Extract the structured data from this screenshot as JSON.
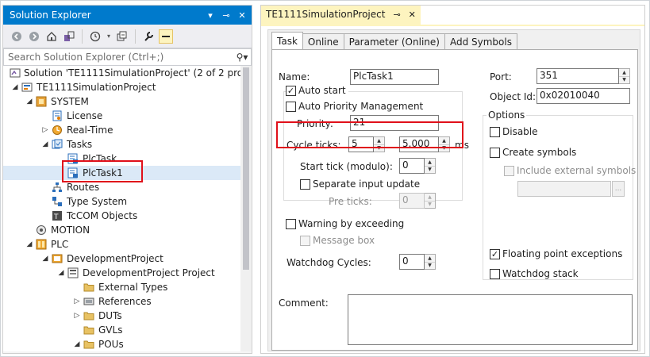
{
  "solution_explorer": {
    "title": "Solution Explorer",
    "title_icons": [
      "dropdown-arrow-icon",
      "pin-icon",
      "close-icon"
    ],
    "search_placeholder": "Search Solution Explorer (Ctrl+;)",
    "tree": [
      {
        "label": "Solution 'TE1111SimulationProject' (2 of 2 project",
        "icon": "solution-icon",
        "level": 0,
        "arrow": ""
      },
      {
        "label": "TE1111SimulationProject",
        "icon": "twincat-project-icon",
        "level": 0,
        "arrow": "expanded"
      },
      {
        "label": "SYSTEM",
        "icon": "system-icon",
        "level": 1,
        "arrow": "expanded"
      },
      {
        "label": "License",
        "icon": "license-icon",
        "level": 2,
        "arrow": ""
      },
      {
        "label": "Real-Time",
        "icon": "realtime-icon",
        "level": 2,
        "arrow": "collapsed"
      },
      {
        "label": "Tasks",
        "icon": "tasks-icon",
        "level": 2,
        "arrow": "expanded"
      },
      {
        "label": "PlcTask",
        "icon": "task-icon",
        "level": 3,
        "arrow": ""
      },
      {
        "label": "PlcTask1",
        "icon": "task-icon",
        "level": 3,
        "arrow": "",
        "selected": true
      },
      {
        "label": "Routes",
        "icon": "routes-icon",
        "level": 2,
        "arrow": ""
      },
      {
        "label": "Type System",
        "icon": "type-system-icon",
        "level": 2,
        "arrow": ""
      },
      {
        "label": "TcCOM Objects",
        "icon": "tccom-icon",
        "level": 2,
        "arrow": ""
      },
      {
        "label": "MOTION",
        "icon": "motion-icon",
        "level": 1,
        "arrow": ""
      },
      {
        "label": "PLC",
        "icon": "plc-icon",
        "level": 1,
        "arrow": "expanded"
      },
      {
        "label": "DevelopmentProject",
        "icon": "plc-project-icon",
        "level": 2,
        "arrow": "expanded"
      },
      {
        "label": "DevelopmentProject Project",
        "icon": "plc-project-file-icon",
        "level": 3,
        "arrow": "expanded"
      },
      {
        "label": "External Types",
        "icon": "folder-icon",
        "level": 4,
        "arrow": ""
      },
      {
        "label": "References",
        "icon": "references-icon",
        "level": 4,
        "arrow": "collapsed"
      },
      {
        "label": "DUTs",
        "icon": "folder-icon",
        "level": 4,
        "arrow": "collapsed"
      },
      {
        "label": "GVLs",
        "icon": "folder-icon",
        "level": 4,
        "arrow": ""
      },
      {
        "label": "POUs",
        "icon": "folder-icon",
        "level": 4,
        "arrow": "expanded"
      }
    ]
  },
  "document": {
    "tab_title": "TE1111SimulationProject",
    "tab_pin": "⊸",
    "tab_close": "✕",
    "tabs": [
      "Task",
      "Online",
      "Parameter (Online)",
      "Add Symbols"
    ],
    "active_tab": "Task",
    "form": {
      "name_label": "Name:",
      "name_value": "PlcTask1",
      "port_label": "Port:",
      "port_value": "351",
      "object_id_label": "Object Id:",
      "object_id_value": "0x02010040",
      "auto_start_label": "Auto start",
      "auto_start_checked": true,
      "auto_priority_label": "Auto Priority Management",
      "auto_priority_checked": false,
      "priority_label": "Priority:",
      "priority_value": "21",
      "cycle_ticks_label": "Cycle ticks:",
      "cycle_ticks_value": "5",
      "cycle_time_value": "5.000",
      "cycle_time_unit": "ms",
      "start_tick_label": "Start tick (modulo):",
      "start_tick_value": "0",
      "separate_input_label": "Separate input update",
      "separate_input_checked": false,
      "pre_ticks_label": "Pre ticks:",
      "pre_ticks_value": "0",
      "warning_label": "Warning by exceeding",
      "warning_checked": false,
      "message_box_label": "Message box",
      "message_box_checked": false,
      "watchdog_label": "Watchdog Cycles:",
      "watchdog_value": "0",
      "options_label": "Options",
      "disable_label": "Disable",
      "disable_checked": false,
      "create_symbols_label": "Create symbols",
      "create_symbols_checked": false,
      "include_external_label": "Include external symbols",
      "include_external_checked": false,
      "browse_button": "...",
      "floating_point_label": "Floating point exceptions",
      "floating_point_checked": true,
      "watchdog_stack_label": "Watchdog stack",
      "watchdog_stack_checked": false,
      "comment_label": "Comment:",
      "comment_value": ""
    }
  },
  "colors": {
    "accent": "#007acc",
    "highlight": "#e0101a",
    "tab_yellow": "#fdf4bf",
    "selection": "#dbe9f7"
  }
}
